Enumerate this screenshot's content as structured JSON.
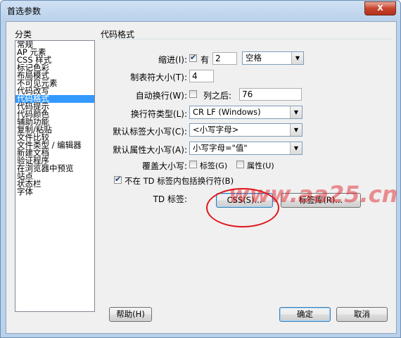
{
  "window": {
    "title": "首选参数",
    "close_glyph": "X"
  },
  "categories": {
    "heading": "分类",
    "items": [
      "常规",
      "AP 元素",
      "CSS 样式",
      "标记色彩",
      "布局模式",
      "不可见元素",
      "代码改写",
      "代码格式",
      "代码提示",
      "代码颜色",
      "辅助功能",
      "复制/粘贴",
      "文件比较",
      "文件类型 / 编辑器",
      "新建文档",
      "验证程序",
      "在浏览器中预览",
      "站点",
      "状态栏",
      "字体"
    ],
    "selected": "代码格式"
  },
  "section_title": "代码格式",
  "indent": {
    "label": "缩进(I):",
    "checked": true,
    "check_label": "有",
    "value": "2",
    "unit": "空格"
  },
  "tab_size": {
    "label": "制表符大小(T):",
    "value": "4"
  },
  "wrap": {
    "label": "自动换行(W):",
    "checked": false,
    "check_label": "列之后:",
    "value": "76"
  },
  "line_break": {
    "label": "换行符类型(L):",
    "value": "CR LF (Windows)"
  },
  "tag_case": {
    "label": "默认标签大小写(C):",
    "value": "<小写字母>"
  },
  "attr_case": {
    "label": "默认属性大小写(A):",
    "value": "小写字母=\"值\""
  },
  "override_case": {
    "label": "覆盖大小写:",
    "tags_label": "标签(G)",
    "tags_checked": false,
    "attrs_label": "属性(U)",
    "attrs_checked": false
  },
  "no_break_td": {
    "checked": true,
    "label": "不在 TD 标签内包括换行符(B)"
  },
  "td_tag": {
    "label": "TD 标签:",
    "css_button": "CSS(S)...",
    "tag_lib_button": "标签库(R)..."
  },
  "footer": {
    "help": "帮助(H)",
    "ok": "确定",
    "cancel": "取消"
  },
  "watermark": "www.aa25.cn",
  "colors": {
    "selection": "#3399ff",
    "annotation": "#e0141a"
  }
}
